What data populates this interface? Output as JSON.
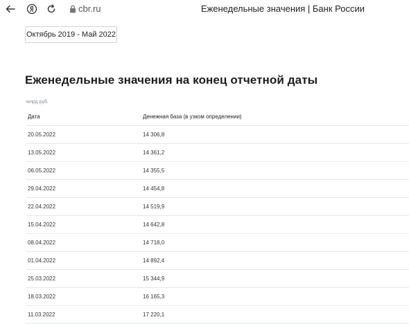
{
  "browser": {
    "url": "cbr.ru",
    "tab_title": "Еженедельные значения | Банк России",
    "icons": [
      "back-arrow-icon",
      "yandex-icon",
      "reload-icon",
      "lock-icon"
    ]
  },
  "period_button": {
    "label": "Октябрь 2019 - Май 2022"
  },
  "page_title": "Еженедельные значения на конец отчетной даты",
  "units": "млрд руб.",
  "table": {
    "headers": [
      "Дата",
      "Денежная база (в узком определении)"
    ],
    "rows": [
      [
        "20.05.2022",
        "14 306,8"
      ],
      [
        "13.05.2022",
        "14 361,2"
      ],
      [
        "06.05.2022",
        "14 355,5"
      ],
      [
        "29.04.2022",
        "14 454,8"
      ],
      [
        "22.04.2022",
        "14 519,9"
      ],
      [
        "15.04.2022",
        "14 642,8"
      ],
      [
        "08.04.2022",
        "14 718,0"
      ],
      [
        "01.04.2022",
        "14 892,4"
      ],
      [
        "25.03.2022",
        "15 344,9"
      ],
      [
        "18.03.2022",
        "16 165,3"
      ],
      [
        "11.03.2022",
        "17 220,1"
      ]
    ]
  },
  "colors": {
    "border": "#e4e6e9",
    "button_border": "#cfd3d8",
    "muted_text": "#8a8f96"
  }
}
